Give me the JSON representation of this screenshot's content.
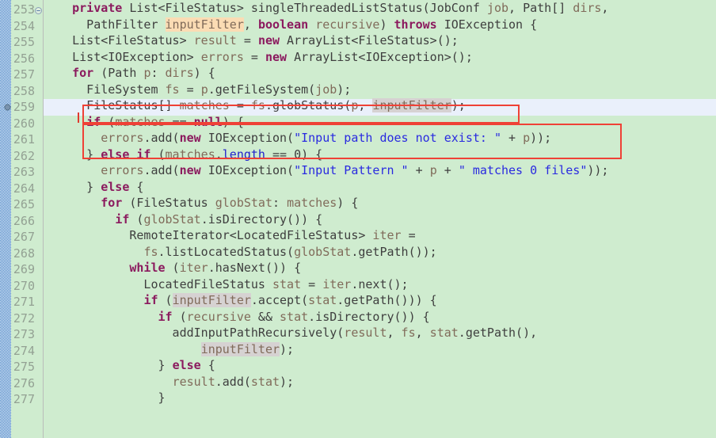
{
  "editor": {
    "app": "java-source-editor",
    "language": "java",
    "colors": {
      "background": "#cfeccf",
      "gutter": "#cfeccf",
      "current_line": "#eaf0fb",
      "annotation_box": "#ef4136",
      "keyword": "#8b1a5e",
      "string": "#2a2ae0",
      "field": "#2222cc",
      "variable": "#806b5a",
      "plain": "#3e3e3e",
      "line_number": "#93a193",
      "occurrence_read": "#d6d2d2",
      "occurrence_write": "#fbdcb4",
      "change_bar": "#2f74c0"
    },
    "first_line_number": 253,
    "current_line_number": 259,
    "fold_marker_line": 253,
    "breakpoint_marker_line": 259
  },
  "annotations": [
    {
      "name": "redbox-line-259",
      "label": "FileStatus[] matches = fs.globStatus(p, inputFilter);"
    },
    {
      "name": "redbox-lines-260-261",
      "label": "if (matches == null) { errors.add(new IOException(\"Input path does not exist: \" + p)); "
    }
  ],
  "lines": [
    {
      "num": "253",
      "fold": "collapse-minus-icon",
      "tokens": [
        {
          "t": "    ",
          "c": "plain"
        },
        {
          "t": "private",
          "c": "kw"
        },
        {
          "t": " List<FileStatus> singleThreadedListStatus(JobConf ",
          "c": "plain"
        },
        {
          "t": "job",
          "c": "var"
        },
        {
          "t": ", Path[] ",
          "c": "plain"
        },
        {
          "t": "dirs",
          "c": "var"
        },
        {
          "t": ",",
          "c": "plain"
        }
      ]
    },
    {
      "num": "254",
      "tokens": [
        {
          "t": "      PathFilter ",
          "c": "plain"
        },
        {
          "t": "inputFilter",
          "c": "var occ-w"
        },
        {
          "t": ", ",
          "c": "plain"
        },
        {
          "t": "boolean",
          "c": "kw"
        },
        {
          "t": " ",
          "c": "plain"
        },
        {
          "t": "recursive",
          "c": "var"
        },
        {
          "t": ") ",
          "c": "plain"
        },
        {
          "t": "throws",
          "c": "kw"
        },
        {
          "t": " IOException {",
          "c": "plain"
        }
      ]
    },
    {
      "num": "255",
      "tokens": [
        {
          "t": "    List<FileStatus> ",
          "c": "plain"
        },
        {
          "t": "result",
          "c": "var"
        },
        {
          "t": " = ",
          "c": "plain"
        },
        {
          "t": "new",
          "c": "kw"
        },
        {
          "t": " ArrayList<FileStatus>();",
          "c": "plain"
        }
      ]
    },
    {
      "num": "256",
      "tokens": [
        {
          "t": "    List<IOException> ",
          "c": "plain"
        },
        {
          "t": "errors",
          "c": "var"
        },
        {
          "t": " = ",
          "c": "plain"
        },
        {
          "t": "new",
          "c": "kw"
        },
        {
          "t": " ArrayList<IOException>();",
          "c": "plain"
        }
      ]
    },
    {
      "num": "257",
      "tokens": [
        {
          "t": "    ",
          "c": "plain"
        },
        {
          "t": "for",
          "c": "kw"
        },
        {
          "t": " (Path ",
          "c": "plain"
        },
        {
          "t": "p",
          "c": "var"
        },
        {
          "t": ": ",
          "c": "plain"
        },
        {
          "t": "dirs",
          "c": "var"
        },
        {
          "t": ") {",
          "c": "plain"
        }
      ]
    },
    {
      "num": "258",
      "tokens": [
        {
          "t": "      FileSystem ",
          "c": "plain"
        },
        {
          "t": "fs",
          "c": "var"
        },
        {
          "t": " = ",
          "c": "plain"
        },
        {
          "t": "p",
          "c": "var"
        },
        {
          "t": ".getFileSystem(",
          "c": "plain"
        },
        {
          "t": "job",
          "c": "var"
        },
        {
          "t": ");",
          "c": "plain"
        }
      ]
    },
    {
      "num": "259",
      "current": true,
      "breakpoint": "breakpoint-dot-icon",
      "tokens": [
        {
          "t": "      FileStatus[] ",
          "c": "plain"
        },
        {
          "t": "matches",
          "c": "var"
        },
        {
          "t": " = ",
          "c": "plain"
        },
        {
          "t": "fs",
          "c": "var"
        },
        {
          "t": ".globStatus(",
          "c": "plain"
        },
        {
          "t": "p",
          "c": "var"
        },
        {
          "t": ", ",
          "c": "plain"
        },
        {
          "t": "inputFilter",
          "c": "var occ"
        },
        {
          "t": ");",
          "c": "plain"
        }
      ]
    },
    {
      "num": "260",
      "tokens": [
        {
          "t": "      ",
          "c": "plain"
        },
        {
          "t": "if",
          "c": "kw"
        },
        {
          "t": " (",
          "c": "plain"
        },
        {
          "t": "matches",
          "c": "var"
        },
        {
          "t": " == ",
          "c": "plain"
        },
        {
          "t": "null",
          "c": "kw"
        },
        {
          "t": ") {",
          "c": "plain"
        }
      ]
    },
    {
      "num": "261",
      "tokens": [
        {
          "t": "        ",
          "c": "plain"
        },
        {
          "t": "errors",
          "c": "var"
        },
        {
          "t": ".add(",
          "c": "plain"
        },
        {
          "t": "new",
          "c": "kw"
        },
        {
          "t": " IOException(",
          "c": "plain"
        },
        {
          "t": "\"Input path does not exist: \"",
          "c": "str"
        },
        {
          "t": " + ",
          "c": "plain"
        },
        {
          "t": "p",
          "c": "var"
        },
        {
          "t": "));",
          "c": "plain"
        }
      ]
    },
    {
      "num": "262",
      "tokens": [
        {
          "t": "      } ",
          "c": "plain"
        },
        {
          "t": "else if",
          "c": "kw"
        },
        {
          "t": " (",
          "c": "plain"
        },
        {
          "t": "matches",
          "c": "var"
        },
        {
          "t": ".",
          "c": "plain"
        },
        {
          "t": "length",
          "c": "field"
        },
        {
          "t": " == ",
          "c": "plain"
        },
        {
          "t": "0",
          "c": "num"
        },
        {
          "t": ") {",
          "c": "plain"
        }
      ]
    },
    {
      "num": "263",
      "tokens": [
        {
          "t": "        ",
          "c": "plain"
        },
        {
          "t": "errors",
          "c": "var"
        },
        {
          "t": ".add(",
          "c": "plain"
        },
        {
          "t": "new",
          "c": "kw"
        },
        {
          "t": " IOException(",
          "c": "plain"
        },
        {
          "t": "\"Input Pattern \"",
          "c": "str"
        },
        {
          "t": " + ",
          "c": "plain"
        },
        {
          "t": "p",
          "c": "var"
        },
        {
          "t": " + ",
          "c": "plain"
        },
        {
          "t": "\" matches 0 files\"",
          "c": "str"
        },
        {
          "t": "));",
          "c": "plain"
        }
      ]
    },
    {
      "num": "264",
      "tokens": [
        {
          "t": "      } ",
          "c": "plain"
        },
        {
          "t": "else",
          "c": "kw"
        },
        {
          "t": " {",
          "c": "plain"
        }
      ]
    },
    {
      "num": "265",
      "tokens": [
        {
          "t": "        ",
          "c": "plain"
        },
        {
          "t": "for",
          "c": "kw"
        },
        {
          "t": " (FileStatus ",
          "c": "plain"
        },
        {
          "t": "globStat",
          "c": "var"
        },
        {
          "t": ": ",
          "c": "plain"
        },
        {
          "t": "matches",
          "c": "var"
        },
        {
          "t": ") {",
          "c": "plain"
        }
      ]
    },
    {
      "num": "266",
      "tokens": [
        {
          "t": "          ",
          "c": "plain"
        },
        {
          "t": "if",
          "c": "kw"
        },
        {
          "t": " (",
          "c": "plain"
        },
        {
          "t": "globStat",
          "c": "var"
        },
        {
          "t": ".isDirectory()) {",
          "c": "plain"
        }
      ]
    },
    {
      "num": "267",
      "tokens": [
        {
          "t": "            RemoteIterator<LocatedFileStatus> ",
          "c": "plain"
        },
        {
          "t": "iter",
          "c": "var"
        },
        {
          "t": " =",
          "c": "plain"
        }
      ]
    },
    {
      "num": "268",
      "tokens": [
        {
          "t": "              ",
          "c": "plain"
        },
        {
          "t": "fs",
          "c": "var"
        },
        {
          "t": ".listLocatedStatus(",
          "c": "plain"
        },
        {
          "t": "globStat",
          "c": "var"
        },
        {
          "t": ".getPath());",
          "c": "plain"
        }
      ]
    },
    {
      "num": "269",
      "tokens": [
        {
          "t": "            ",
          "c": "plain"
        },
        {
          "t": "while",
          "c": "kw"
        },
        {
          "t": " (",
          "c": "plain"
        },
        {
          "t": "iter",
          "c": "var"
        },
        {
          "t": ".hasNext()) {",
          "c": "plain"
        }
      ]
    },
    {
      "num": "270",
      "tokens": [
        {
          "t": "              LocatedFileStatus ",
          "c": "plain"
        },
        {
          "t": "stat",
          "c": "var"
        },
        {
          "t": " = ",
          "c": "plain"
        },
        {
          "t": "iter",
          "c": "var"
        },
        {
          "t": ".next();",
          "c": "plain"
        }
      ]
    },
    {
      "num": "271",
      "tokens": [
        {
          "t": "              ",
          "c": "plain"
        },
        {
          "t": "if",
          "c": "kw"
        },
        {
          "t": " (",
          "c": "plain"
        },
        {
          "t": "inputFilter",
          "c": "var occ"
        },
        {
          "t": ".accept(",
          "c": "plain"
        },
        {
          "t": "stat",
          "c": "var"
        },
        {
          "t": ".getPath())) {",
          "c": "plain"
        }
      ]
    },
    {
      "num": "272",
      "tokens": [
        {
          "t": "                ",
          "c": "plain"
        },
        {
          "t": "if",
          "c": "kw"
        },
        {
          "t": " (",
          "c": "plain"
        },
        {
          "t": "recursive",
          "c": "var"
        },
        {
          "t": " && ",
          "c": "plain"
        },
        {
          "t": "stat",
          "c": "var"
        },
        {
          "t": ".isDirectory()) {",
          "c": "plain"
        }
      ]
    },
    {
      "num": "273",
      "tokens": [
        {
          "t": "                  addInputPathRecursively(",
          "c": "plain"
        },
        {
          "t": "result",
          "c": "var"
        },
        {
          "t": ", ",
          "c": "plain"
        },
        {
          "t": "fs",
          "c": "var"
        },
        {
          "t": ", ",
          "c": "plain"
        },
        {
          "t": "stat",
          "c": "var"
        },
        {
          "t": ".getPath(),",
          "c": "plain"
        }
      ]
    },
    {
      "num": "274",
      "tokens": [
        {
          "t": "                      ",
          "c": "plain"
        },
        {
          "t": "inputFilter",
          "c": "var occ"
        },
        {
          "t": ");",
          "c": "plain"
        }
      ]
    },
    {
      "num": "275",
      "tokens": [
        {
          "t": "                } ",
          "c": "plain"
        },
        {
          "t": "else",
          "c": "kw"
        },
        {
          "t": " {",
          "c": "plain"
        }
      ]
    },
    {
      "num": "276",
      "tokens": [
        {
          "t": "                  ",
          "c": "plain"
        },
        {
          "t": "result",
          "c": "var"
        },
        {
          "t": ".add(",
          "c": "plain"
        },
        {
          "t": "stat",
          "c": "var"
        },
        {
          "t": ");",
          "c": "plain"
        }
      ]
    },
    {
      "num": "277",
      "tokens": [
        {
          "t": "                }",
          "c": "plain"
        }
      ]
    }
  ]
}
